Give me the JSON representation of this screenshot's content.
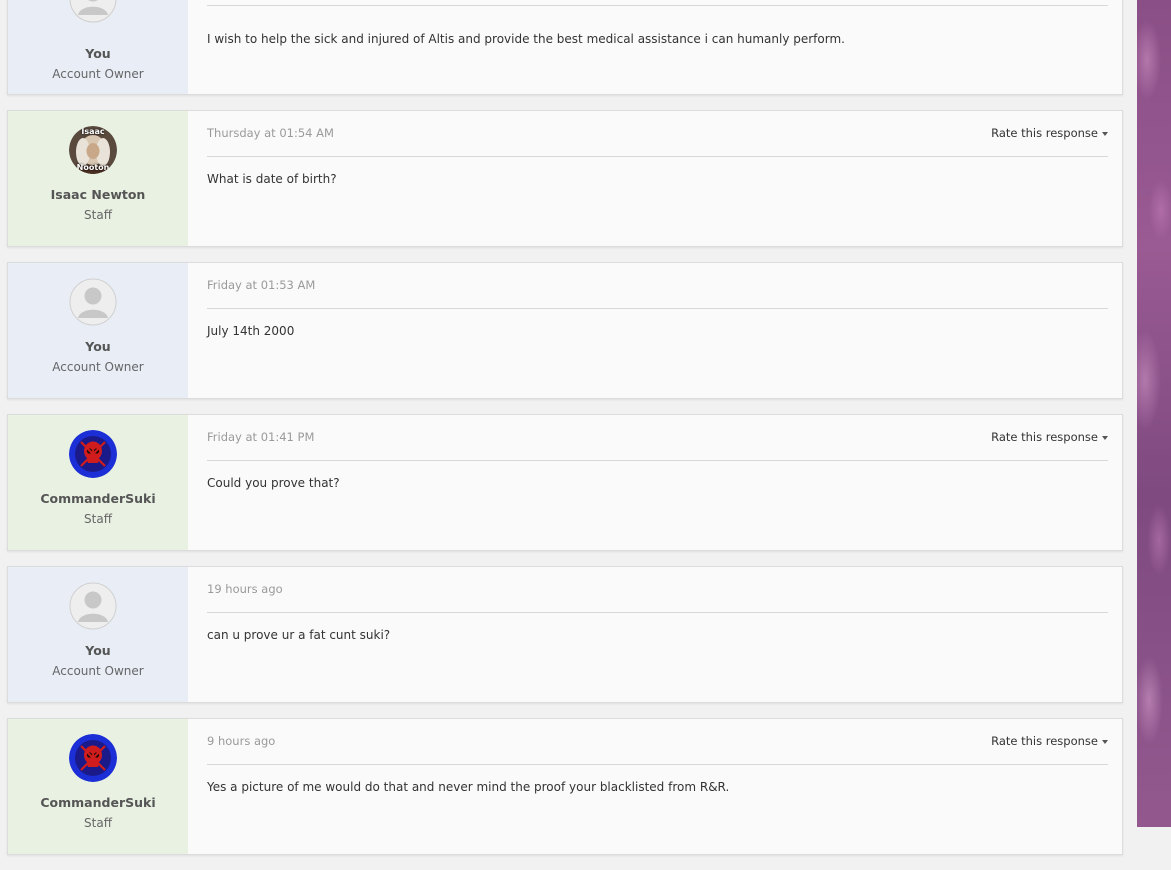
{
  "entries": [
    {
      "author": "You",
      "role": "Account Owner",
      "avatar": "default-user-avatar",
      "timestamp": "",
      "rate_label": "",
      "body": "I wish to help the sick and injured of Altis and provide the best medical assistance i can humanly perform."
    },
    {
      "author": "Isaac Newton",
      "role": "Staff",
      "avatar": "isaac-newton-portrait",
      "avatar_caption_top": "Isaac",
      "avatar_caption_bottom": "Nooton",
      "timestamp": "Thursday at 01:54 AM",
      "rate_label": "Rate this response",
      "body": "What is date of birth?"
    },
    {
      "author": "You",
      "role": "Account Owner",
      "avatar": "default-user-avatar",
      "timestamp": "Friday at 01:53 AM",
      "rate_label": "",
      "body": "July 14th 2000"
    },
    {
      "author": "CommanderSuki",
      "role": "Staff",
      "avatar": "red-skull-avatar",
      "timestamp": "Friday at 01:41 PM",
      "rate_label": "Rate this response",
      "body": "Could you prove that?"
    },
    {
      "author": "You",
      "role": "Account Owner",
      "avatar": "default-user-avatar",
      "timestamp": "19 hours ago",
      "rate_label": "",
      "body": "can u prove ur a fat cunt suki?"
    },
    {
      "author": "CommanderSuki",
      "role": "Staff",
      "avatar": "red-skull-avatar",
      "timestamp": "9 hours ago",
      "rate_label": "Rate this response",
      "body": "Yes a picture of me would do that and never mind the proof your blacklisted from R&R."
    }
  ],
  "colors": {
    "owner_panel": "#e8edf6",
    "staff_panel": "#e8f1e2",
    "side_decoration": "#8a4f86",
    "skull_avatar_bg": "#1c2fd6",
    "skull_color": "#d01c1c"
  }
}
